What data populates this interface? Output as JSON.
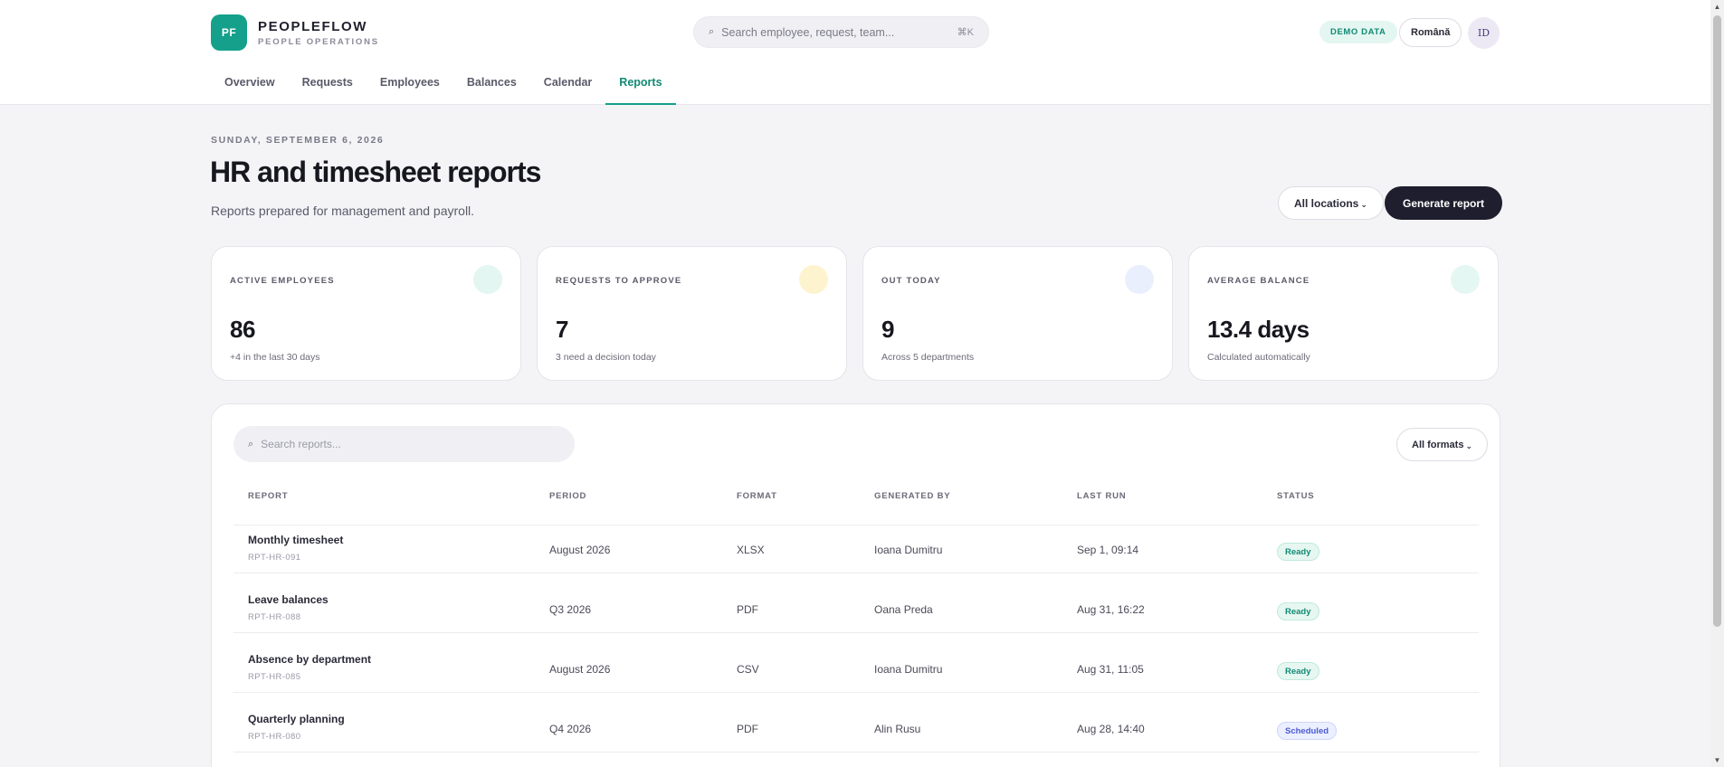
{
  "brand": {
    "logo_text": "PF",
    "name": "PEOPLEFLOW",
    "subtitle": "PEOPLE OPERATIONS"
  },
  "search": {
    "icon": "search-icon",
    "placeholder": "Search employee, request, team...",
    "shortcut": "⌘K"
  },
  "header": {
    "demo_badge": "DEMO DATA",
    "language": "Română",
    "avatar_initials": "ID"
  },
  "nav": {
    "tabs": [
      {
        "label": "Overview"
      },
      {
        "label": "Requests"
      },
      {
        "label": "Employees"
      },
      {
        "label": "Balances"
      },
      {
        "label": "Calendar"
      },
      {
        "label": "Reports",
        "active": true
      }
    ]
  },
  "page": {
    "date": "SUNDAY, SEPTEMBER 6, 2026",
    "title": "HR and timesheet reports",
    "subtitle": "Reports prepared for management and payroll.",
    "locations_filter": "All locations",
    "generate_button": "Generate report"
  },
  "stats": [
    {
      "label": "ACTIVE EMPLOYEES",
      "value": "86",
      "note": "+4 in the last 30 days",
      "color": "#e3f6f1"
    },
    {
      "label": "REQUESTS TO APPROVE",
      "value": "7",
      "note": "3 need a decision today",
      "color": "#fdf4cf"
    },
    {
      "label": "OUT TODAY",
      "value": "9",
      "note": "Across 5 departments",
      "color": "#e9effc"
    },
    {
      "label": "AVERAGE BALANCE",
      "value": "13.4 days",
      "note": "Calculated automatically",
      "color": "#e5f7f2"
    }
  ],
  "reports": {
    "search_placeholder": "Search reports...",
    "formats_filter": "All formats",
    "columns": [
      "REPORT",
      "PERIOD",
      "FORMAT",
      "GENERATED BY",
      "LAST RUN",
      "STATUS"
    ],
    "rows": [
      {
        "name": "Monthly timesheet",
        "id": "RPT-HR-091",
        "period": "August 2026",
        "format": "XLSX",
        "generated_by": "Ioana Dumitru",
        "last_run": "Sep 1, 09:14",
        "status": "Ready"
      },
      {
        "name": "Leave balances",
        "id": "RPT-HR-088",
        "period": "Q3 2026",
        "format": "PDF",
        "generated_by": "Oana Preda",
        "last_run": "Aug 31, 16:22",
        "status": "Ready"
      },
      {
        "name": "Absence by department",
        "id": "RPT-HR-085",
        "period": "August 2026",
        "format": "CSV",
        "generated_by": "Ioana Dumitru",
        "last_run": "Aug 31, 11:05",
        "status": "Ready"
      },
      {
        "name": "Quarterly planning",
        "id": "RPT-HR-080",
        "period": "Q4 2026",
        "format": "PDF",
        "generated_by": "Alin Rusu",
        "last_run": "Aug 28, 14:40",
        "status": "Scheduled"
      }
    ]
  },
  "colors": {
    "accent": "#14a08a",
    "dark_button": "#1e1e2e",
    "background": "#f4f4f7"
  }
}
